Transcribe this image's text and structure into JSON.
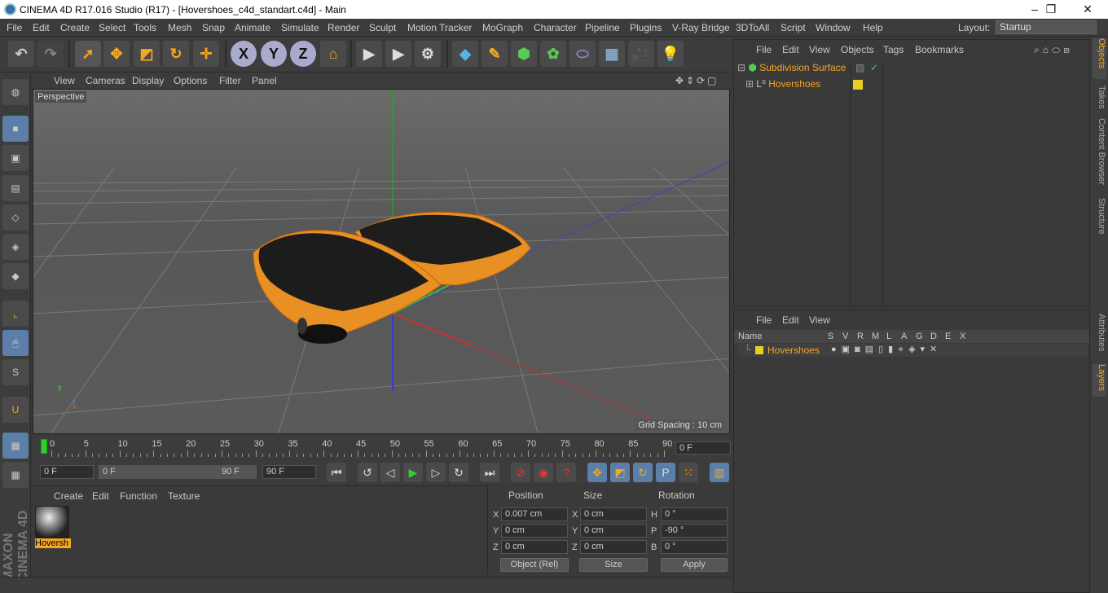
{
  "window": {
    "title": "CINEMA 4D R17.016 Studio (R17) - [Hovershoes_c4d_standart.c4d] - Main"
  },
  "menu": [
    "File",
    "Edit",
    "Create",
    "Select",
    "Tools",
    "Mesh",
    "Snap",
    "Animate",
    "Simulate",
    "Render",
    "Sculpt",
    "Motion Tracker",
    "MoGraph",
    "Character",
    "Pipeline",
    "Plugins",
    "V-Ray Bridge",
    "3DToAll",
    "Script",
    "Window",
    "Help"
  ],
  "layout": {
    "label": "Layout:",
    "value": "Startup"
  },
  "toolbar": {
    "x": "X",
    "y": "Y",
    "z": "Z"
  },
  "viewport": {
    "menu": [
      "View",
      "Cameras",
      "Display",
      "Options",
      "Filter",
      "Panel"
    ],
    "label": "Perspective",
    "grid_spacing": "Grid Spacing : 10 cm"
  },
  "timeline": {
    "ticks": [
      "0",
      "5",
      "10",
      "15",
      "20",
      "25",
      "30",
      "35",
      "40",
      "45",
      "50",
      "55",
      "60",
      "65",
      "70",
      "75",
      "80",
      "85",
      "90"
    ],
    "current": "0 F"
  },
  "transport": {
    "start": "0 F",
    "range_start": "0 F",
    "range_end": "90 F",
    "end": "90 F"
  },
  "material": {
    "menu": [
      "Create",
      "Edit",
      "Function",
      "Texture"
    ],
    "name": "Hoversh"
  },
  "coords": {
    "headers": [
      "Position",
      "Size",
      "Rotation"
    ],
    "rows": [
      {
        "axis": "X",
        "pos": "0.007 cm",
        "saxis": "X",
        "size": "0 cm",
        "raxis": "H",
        "rot": "0 °"
      },
      {
        "axis": "Y",
        "pos": "0 cm",
        "saxis": "Y",
        "size": "0 cm",
        "raxis": "P",
        "rot": "-90 °"
      },
      {
        "axis": "Z",
        "pos": "0 cm",
        "saxis": "Z",
        "size": "0 cm",
        "raxis": "B",
        "rot": "0 °"
      }
    ],
    "mode": "Object (Rel)",
    "size_mode": "Size",
    "apply": "Apply"
  },
  "objects": {
    "menu": [
      "File",
      "Edit",
      "View",
      "Objects",
      "Tags",
      "Bookmarks"
    ],
    "items": [
      "Subdivision Surface",
      "Hovershoes"
    ]
  },
  "layers": {
    "menu": [
      "File",
      "Edit",
      "View"
    ],
    "columns": [
      "Name",
      "S",
      "V",
      "R",
      "M",
      "L",
      "A",
      "G",
      "D",
      "E",
      "X"
    ],
    "item": "Hovershoes"
  },
  "right_tabs": [
    "Objects",
    "Takes",
    "Content Browser",
    "Structure",
    "Attributes",
    "Layers"
  ],
  "brand": "MAXON CINEMA 4D",
  "colors": {
    "accent": "#f5a623",
    "bg": "#3a3a3a",
    "select": "#5b7fa8"
  }
}
